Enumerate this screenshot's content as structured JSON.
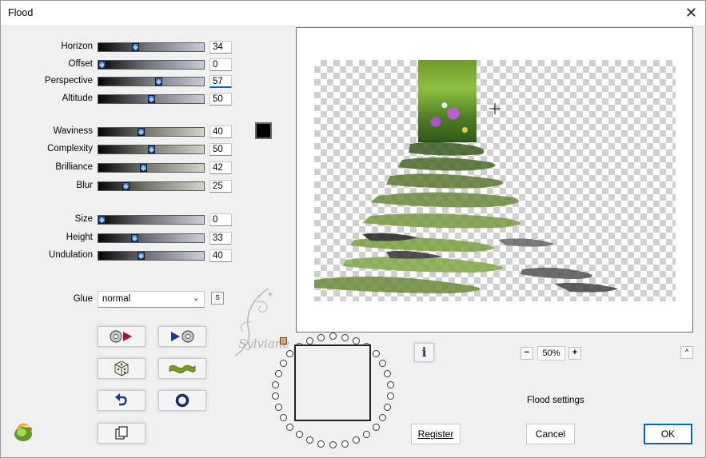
{
  "window": {
    "title": "Flood",
    "close_glyph": "✕"
  },
  "sliders": [
    {
      "label": "Horizon",
      "value": "34",
      "level": 34,
      "style": "a"
    },
    {
      "label": "Offset",
      "value": "0",
      "level": 0,
      "style": "a"
    },
    {
      "label": "Perspective",
      "value": "57",
      "level": 57,
      "style": "a",
      "active": true
    },
    {
      "label": "Altitude",
      "value": "50",
      "level": 50,
      "style": "a"
    },
    {
      "label": "Waviness",
      "value": "40",
      "level": 40,
      "style": "b"
    },
    {
      "label": "Complexity",
      "value": "50",
      "level": 50,
      "style": "b"
    },
    {
      "label": "Brilliance",
      "value": "42",
      "level": 42,
      "style": "b"
    },
    {
      "label": "Blur",
      "value": "25",
      "level": 25,
      "style": "b"
    },
    {
      "label": "Size",
      "value": "0",
      "level": 0,
      "style": "c"
    },
    {
      "label": "Height",
      "value": "33",
      "level": 33,
      "style": "c"
    },
    {
      "label": "Undulation",
      "value": "40",
      "level": 40,
      "style": "c"
    }
  ],
  "color_swatch": {
    "color": "#000000"
  },
  "glue": {
    "label": "Glue",
    "value": "normal",
    "s_button": "S"
  },
  "tool_buttons": [
    {
      "name": "prev-preset-button",
      "icon": "disc-play-reverse-icon"
    },
    {
      "name": "next-preset-button",
      "icon": "play-disc-icon"
    },
    {
      "name": "random-button",
      "icon": "dice-icon"
    },
    {
      "name": "wave-button",
      "icon": "wave-icon"
    },
    {
      "name": "undo-button",
      "icon": "undo-arrow-icon"
    },
    {
      "name": "reset-button",
      "icon": "ring-icon"
    },
    {
      "name": "copy-button",
      "icon": "copy-pages-icon"
    }
  ],
  "zoom": {
    "minus": "−",
    "value": "50%",
    "plus": "+"
  },
  "info_glyph": "i",
  "up_glyph": "^",
  "settings_label": "Flood settings",
  "buttons": {
    "register": "Register",
    "cancel": "Cancel",
    "ok": "OK"
  },
  "watermark_text": "Sylviane",
  "colors": {
    "accent": "#0067c0",
    "thumb": "#1f56a8"
  }
}
